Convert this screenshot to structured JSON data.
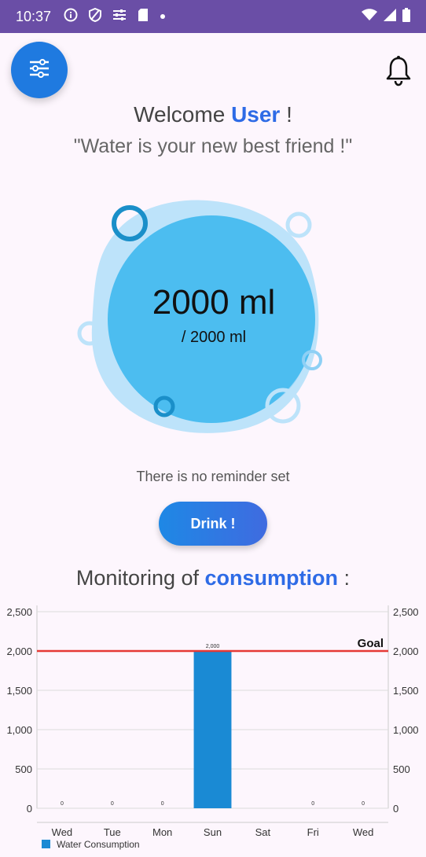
{
  "status_bar": {
    "time": "10:37",
    "icons": [
      "info-icon",
      "shield-icon",
      "sliders-icon",
      "sd-card-icon",
      "dot-icon"
    ],
    "right_icons": [
      "wifi-icon",
      "signal-icon",
      "battery-icon"
    ]
  },
  "header": {
    "welcome_prefix": "Welcome",
    "user_name": "User",
    "welcome_suffix": "!",
    "quote": "\"Water is your new best friend !\""
  },
  "water": {
    "amount": "2000 ml",
    "goal": "/ 2000 ml"
  },
  "reminder": {
    "text": "There is no reminder set"
  },
  "actions": {
    "drink_label": "Drink !"
  },
  "monitor": {
    "prefix": "Monitoring of",
    "highlight": "consumption",
    "suffix": ":"
  },
  "colors": {
    "status_bar": "#6a4ea6",
    "accent": "#2e6be6",
    "bar": "#1a8ad4",
    "goal_line": "#e53935"
  },
  "chart_data": {
    "type": "bar",
    "categories": [
      "Wed",
      "Tue",
      "Mon",
      "Sun",
      "Sat",
      "Fri",
      "Wed"
    ],
    "series": [
      {
        "name": "Water Consumption",
        "values": [
          0,
          0,
          0,
          2000,
          0,
          0,
          0
        ]
      }
    ],
    "data_labels": [
      "0",
      "0",
      "0",
      "2,000",
      "",
      "0",
      "0"
    ],
    "yticks": [
      "0",
      "500",
      "1,000",
      "1,500",
      "2,000",
      "2,500"
    ],
    "ylim": [
      0,
      2500
    ],
    "goal": {
      "value": 2000,
      "label": "Goal"
    },
    "legend": "bottom-left",
    "grid": true
  }
}
